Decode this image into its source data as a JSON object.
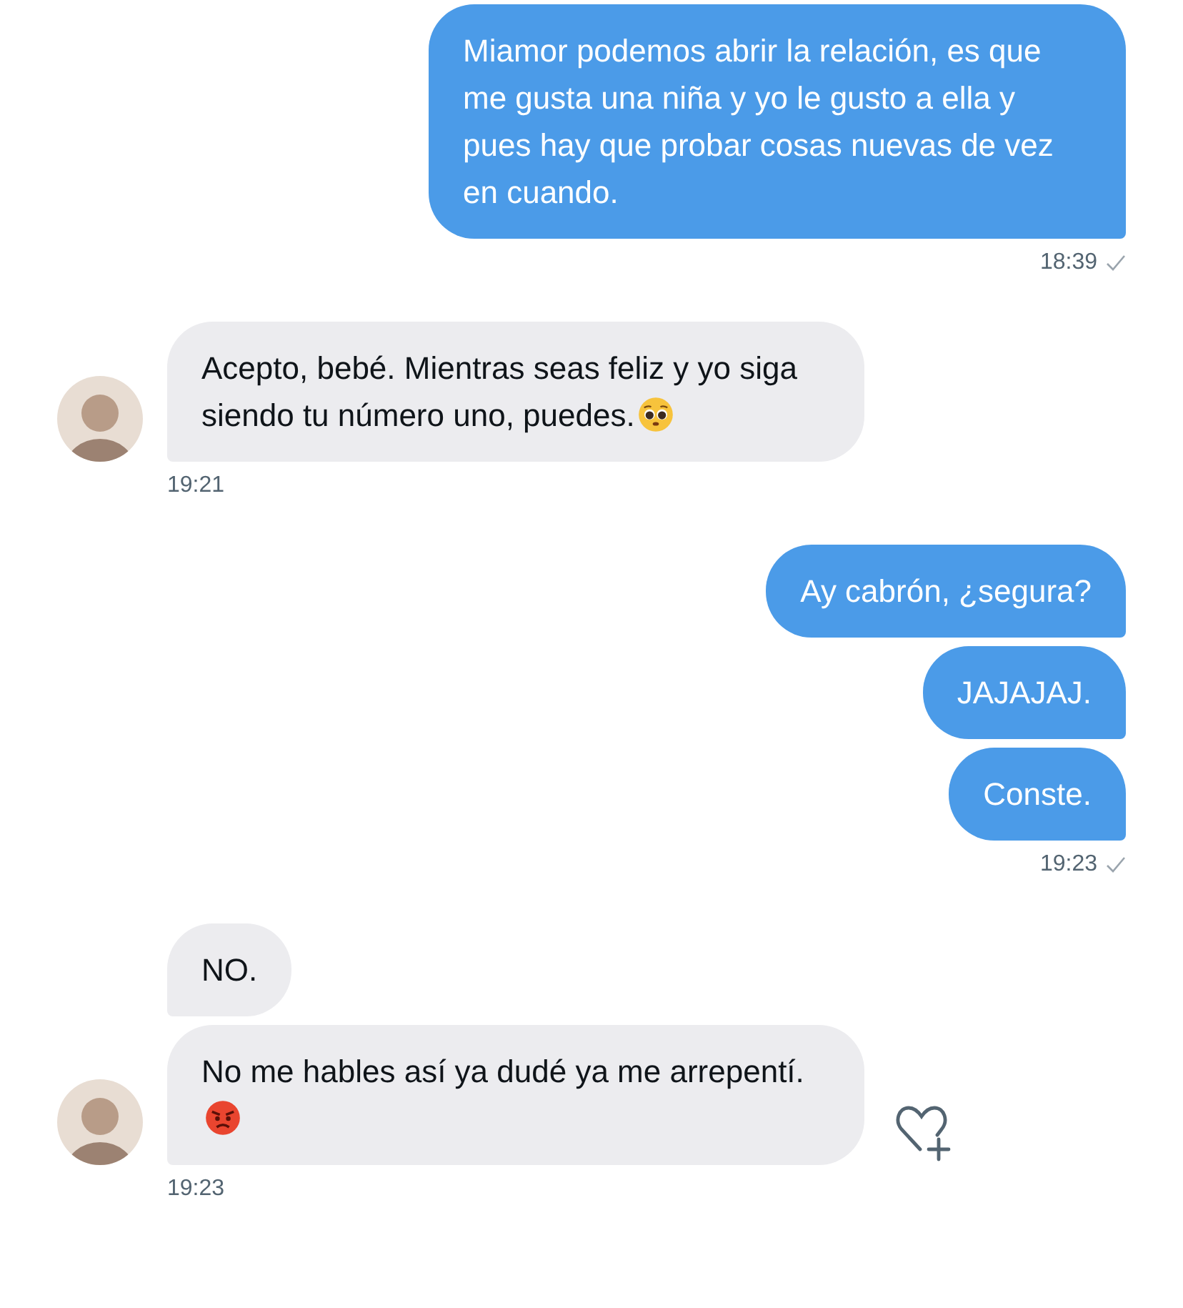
{
  "groups": [
    {
      "kind": "sent",
      "messages": [
        {
          "kind": "plain",
          "text": "Miamor podemos abrir la relación, es que me gusta una niña y yo le gusto a ella y pues hay que probar cosas nuevas de vez en cuando."
        }
      ],
      "time": "18:39",
      "read": true
    },
    {
      "kind": "received",
      "messages": [
        {
          "kind": "pleading",
          "text": "Acepto, bebé. Mientras seas feliz y yo siga siendo tu número uno, puedes."
        }
      ],
      "time": "19:21",
      "avatar": true
    },
    {
      "kind": "sent",
      "messages": [
        {
          "kind": "plain",
          "text": "Ay cabrón, ¿segura?"
        },
        {
          "kind": "plain",
          "text": "JAJAJAJ."
        },
        {
          "kind": "plain",
          "text": "Conste."
        }
      ],
      "time": "19:23",
      "read": true
    },
    {
      "kind": "received",
      "messages": [
        {
          "kind": "plain",
          "text": "NO."
        },
        {
          "kind": "angry",
          "text": "No me hables así ya dudé ya me arrepentí.",
          "react_button": true
        }
      ],
      "time": "19:23",
      "avatar": true
    }
  ]
}
